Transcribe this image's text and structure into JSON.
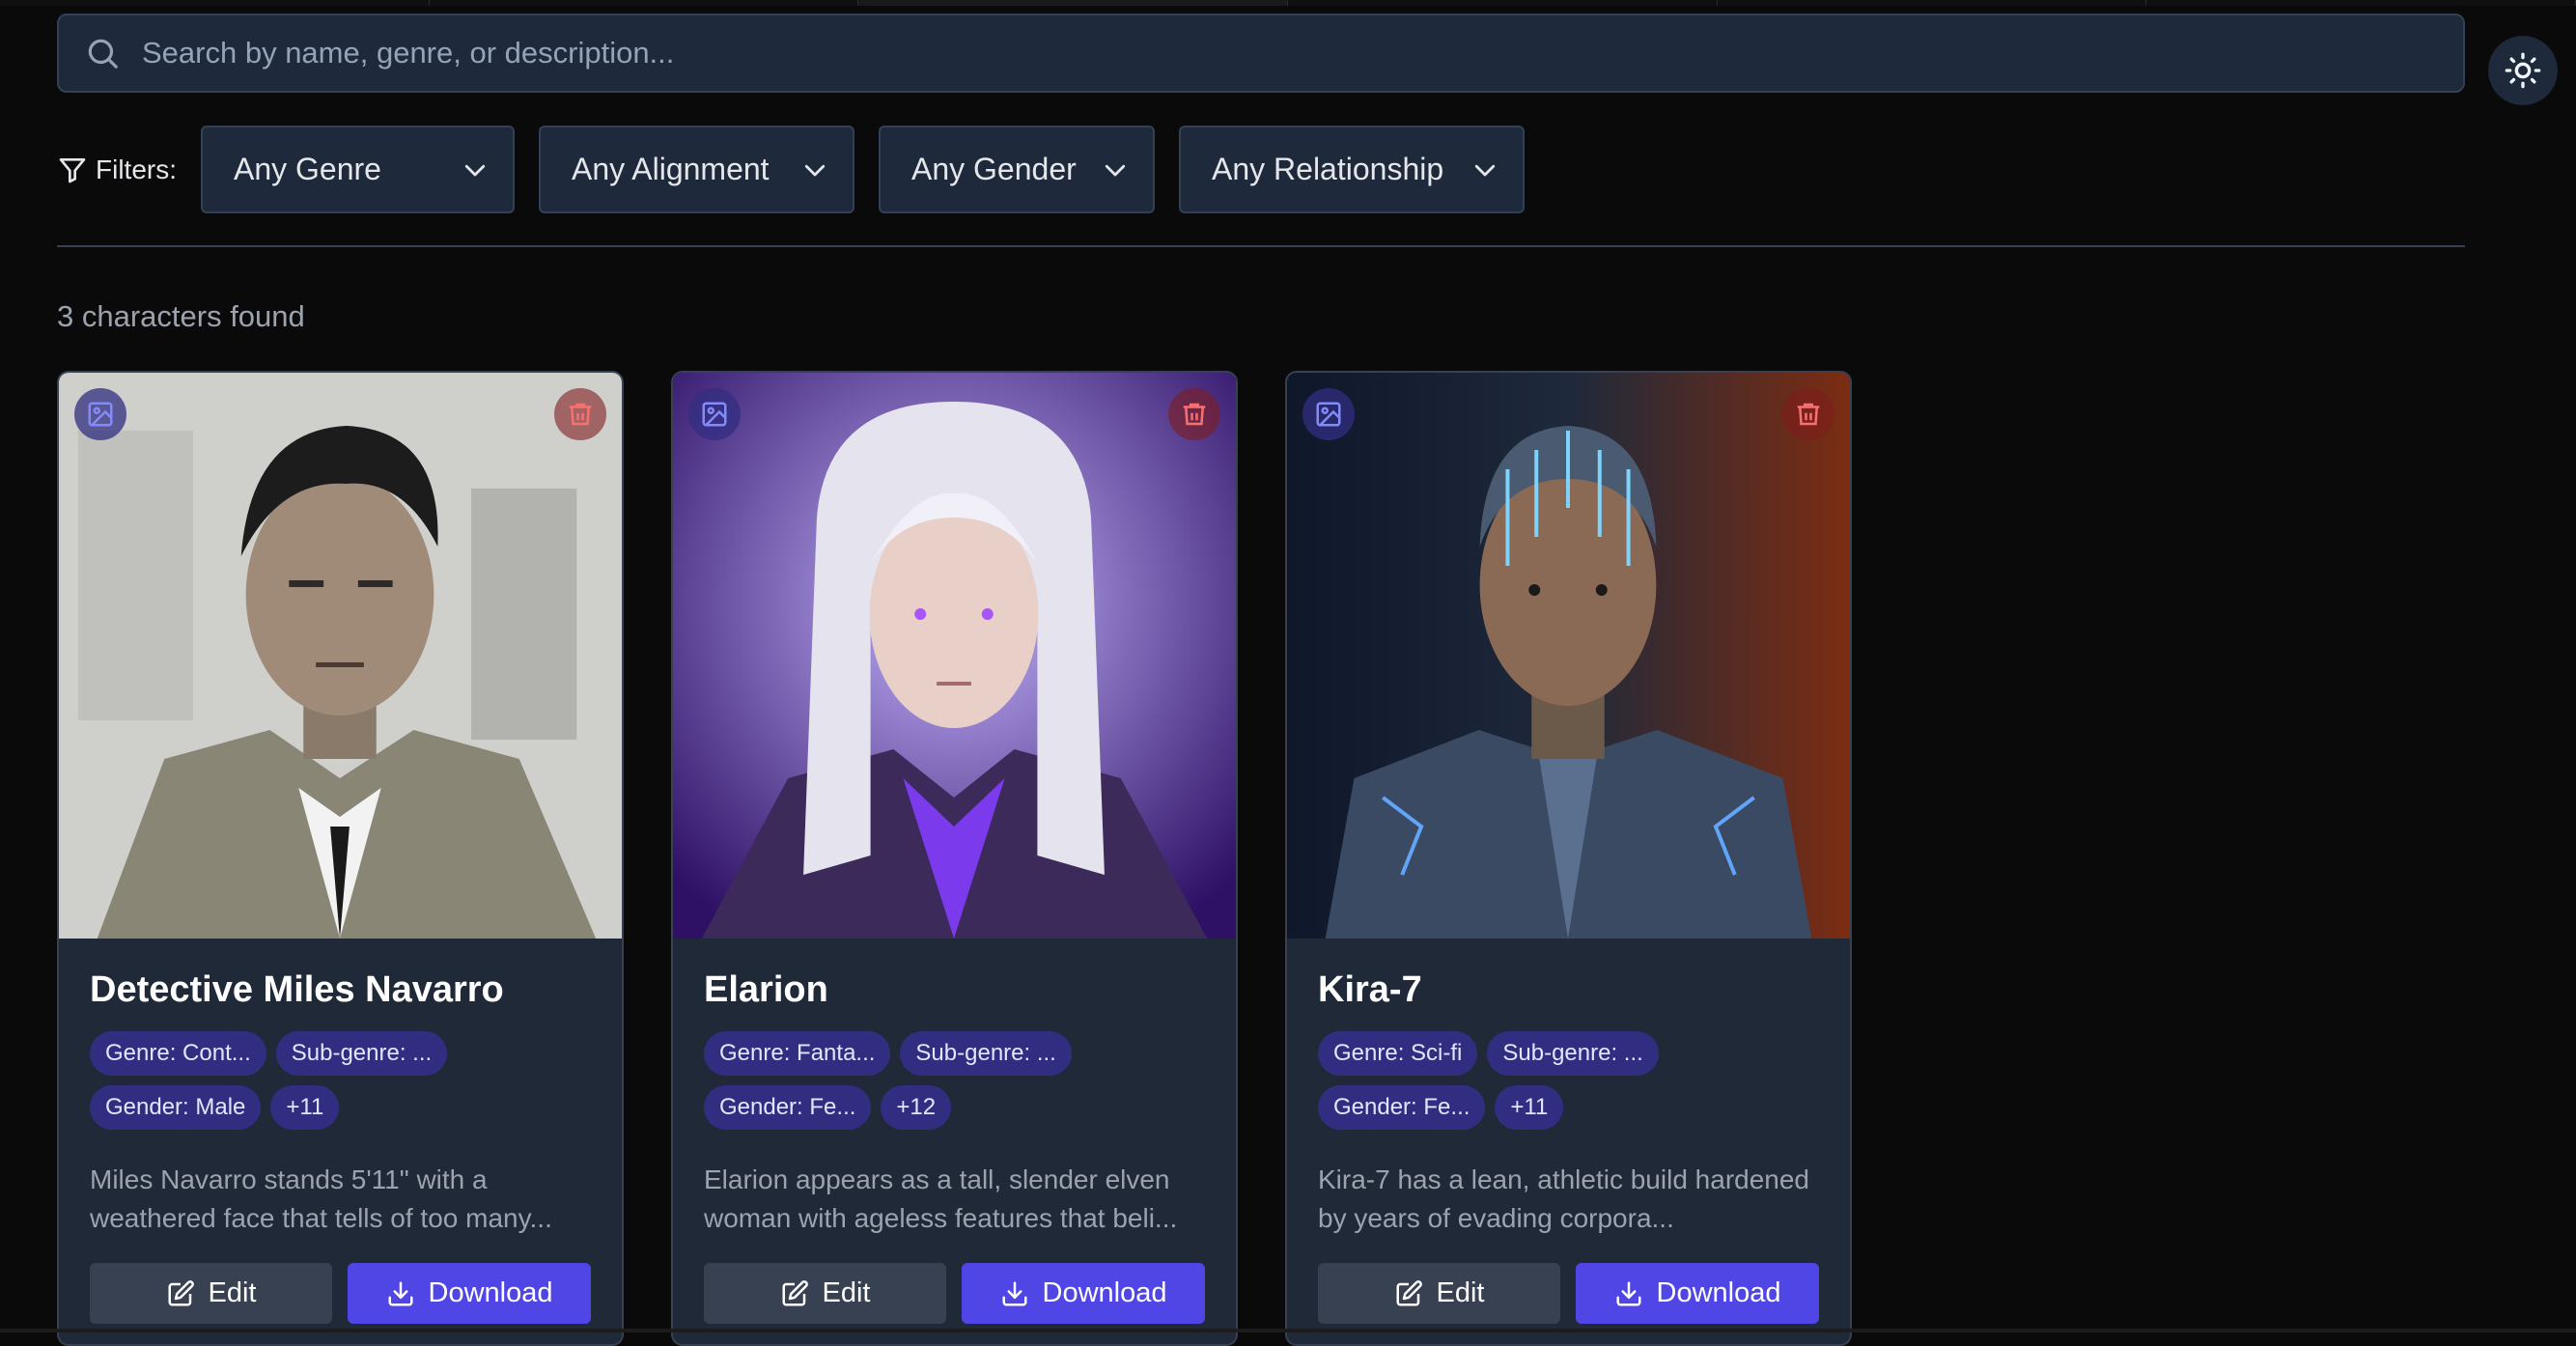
{
  "search": {
    "placeholder": "Search by name, genre, or description..."
  },
  "theme_toggle": {
    "icon": "sun-icon"
  },
  "filters": {
    "label": "Filters:",
    "genre": "Any Genre",
    "alignment": "Any Alignment",
    "gender": "Any Gender",
    "relationship": "Any Relationship"
  },
  "results": {
    "count_text": "3 characters found"
  },
  "cards": [
    {
      "name": "Detective Miles Navarro",
      "tags": [
        "Genre: Cont...",
        "Sub-genre: ...",
        "Gender: Male",
        "+11"
      ],
      "description": "Miles Navarro stands 5'11\" with a weathered face that tells of too many...",
      "edit_label": "Edit",
      "download_label": "Download"
    },
    {
      "name": "Elarion",
      "tags": [
        "Genre: Fanta...",
        "Sub-genre: ...",
        "Gender: Fe...",
        "+12"
      ],
      "description": "Elarion appears as a tall, slender elven woman with ageless features that beli...",
      "edit_label": "Edit",
      "download_label": "Download"
    },
    {
      "name": "Kira-7",
      "tags": [
        "Genre: Sci-fi",
        "Sub-genre: ...",
        "Gender: Fe...",
        "+11"
      ],
      "description": "Kira-7 has a lean, athletic build hardened by years of evading corpora...",
      "edit_label": "Edit",
      "download_label": "Download"
    }
  ],
  "colors": {
    "background": "#0a0a0a",
    "card": "#1f2937",
    "accent": "#4f46e5",
    "tag": "#312e81",
    "delete": "#7f1d1d"
  }
}
